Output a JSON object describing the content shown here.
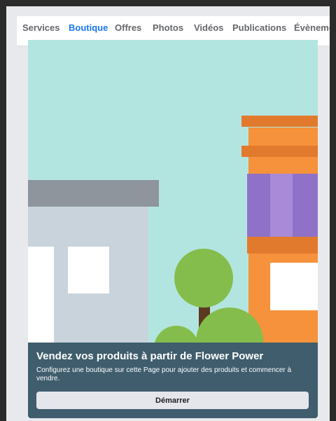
{
  "tabs": [
    {
      "label": "Services",
      "active": false
    },
    {
      "label": "Boutique",
      "active": true
    },
    {
      "label": "Offres",
      "active": false
    },
    {
      "label": "Photos",
      "active": false
    },
    {
      "label": "Vidéos",
      "active": false
    },
    {
      "label": "Publications",
      "active": false
    },
    {
      "label": "Évènements",
      "active": false
    }
  ],
  "shop_panel": {
    "title": "Vendez vos produits à partir de Flower Power",
    "description": "Configurez une boutique sur cette Page pour ajouter des produits et commencer à vendre.",
    "button_label": "Démarrer"
  },
  "colors": {
    "accent": "#1877f2",
    "sky": "#b3e5e0",
    "panel": "#3f5d6d",
    "building_orange": "#f5923b",
    "building_purple": "#8f72c8",
    "tree_green": "#85bd4c"
  }
}
